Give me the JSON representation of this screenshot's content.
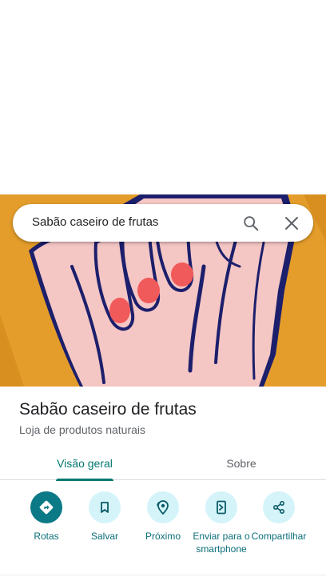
{
  "search": {
    "query": "Sabão caseiro de frutas"
  },
  "place": {
    "name": "Sabão caseiro de frutas",
    "category": "Loja de produtos naturais"
  },
  "tabs": [
    {
      "label": "Visão geral",
      "active": true
    },
    {
      "label": "Sobre",
      "active": false
    }
  ],
  "actions": [
    {
      "label": "Rotas",
      "icon": "directions-icon"
    },
    {
      "label": "Salvar",
      "icon": "bookmark-icon"
    },
    {
      "label": "Próximo",
      "icon": "nearby-icon"
    },
    {
      "label": "Enviar para o smartphone",
      "icon": "send-to-phone-icon"
    },
    {
      "label": "Compartilhar",
      "icon": "share-icon"
    }
  ],
  "colors": {
    "accent": "#01796f",
    "action_primary": "#0b7986",
    "action_secondary": "#d4f4fa",
    "hero_background": "#e49d2b",
    "skin": "#f4c6c4",
    "nail": "#f15a5a",
    "outline": "#1c1f6b"
  }
}
